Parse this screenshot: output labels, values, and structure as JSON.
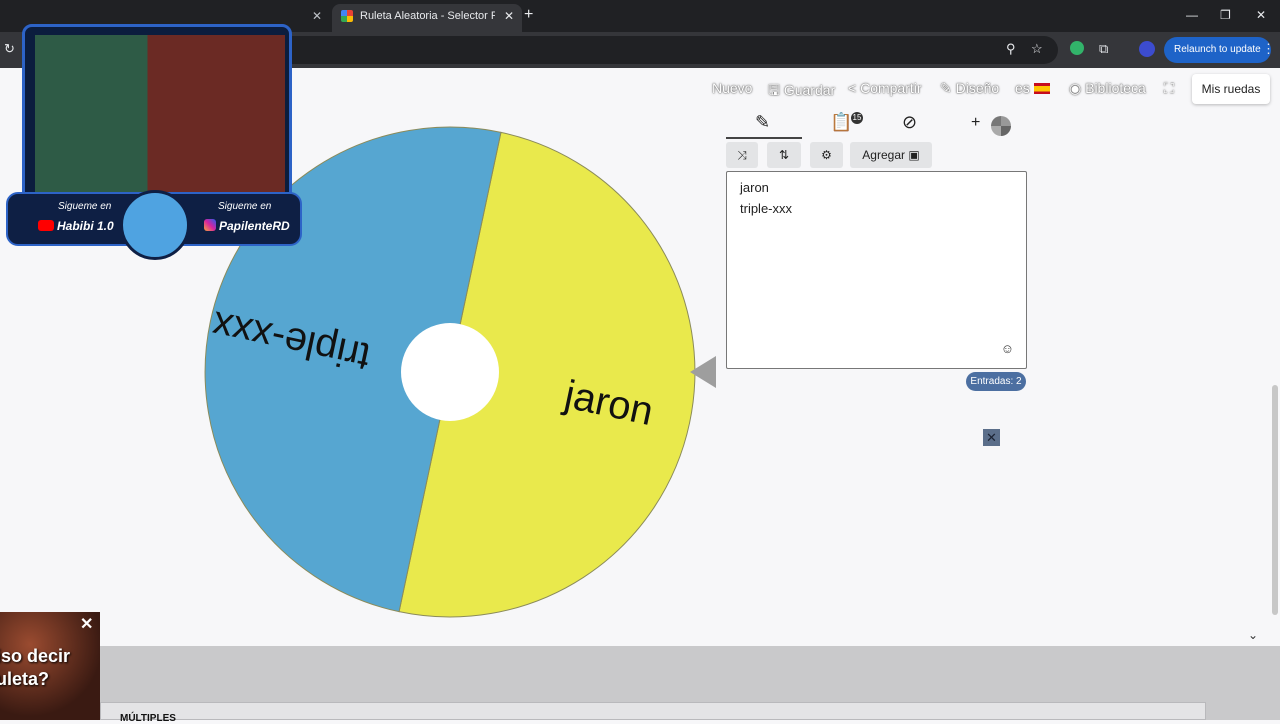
{
  "browser": {
    "tabs": [
      {
        "title": "",
        "active": false
      },
      {
        "title": "Ruleta Aleatoria - Selector Person",
        "active": true
      }
    ],
    "relaunch_label": "Relaunch to update"
  },
  "nav": {
    "items": [
      {
        "label": "Nuevo"
      },
      {
        "label": "Guardar"
      },
      {
        "label": "Compartir"
      },
      {
        "label": "Diseño"
      },
      {
        "label": "es"
      },
      {
        "label": "Biblioteca"
      }
    ],
    "my_wheels_label": "Mis ruedas"
  },
  "wheel": {
    "segments": [
      {
        "label": "jaron",
        "color": "#e9e94c",
        "share": 0.5
      },
      {
        "label": "triple-xxx",
        "color": "#56a6d1",
        "share": 0.5
      }
    ],
    "border_color": "#8b8b5a",
    "pointer_color": "#9e9e9e"
  },
  "editor": {
    "history_count": "15",
    "add_image_label": "Agregar",
    "entries": [
      "jaron",
      "triple-xxx"
    ],
    "entries_count_label": "Entradas: 2"
  },
  "webcam_overlay": {
    "left_line1": "Sigueme en",
    "left_line2": "Habibi 1.0",
    "right_line1": "Sigueme en",
    "right_line2": "PapilenteRD"
  },
  "ad": {
    "text": "iso decir\nuleta?"
  },
  "bottom": {
    "text": "MÚLTIPLES"
  },
  "colors": {
    "accent_badge": "#4c6fa1",
    "relaunch_button": "#1e63c8"
  }
}
